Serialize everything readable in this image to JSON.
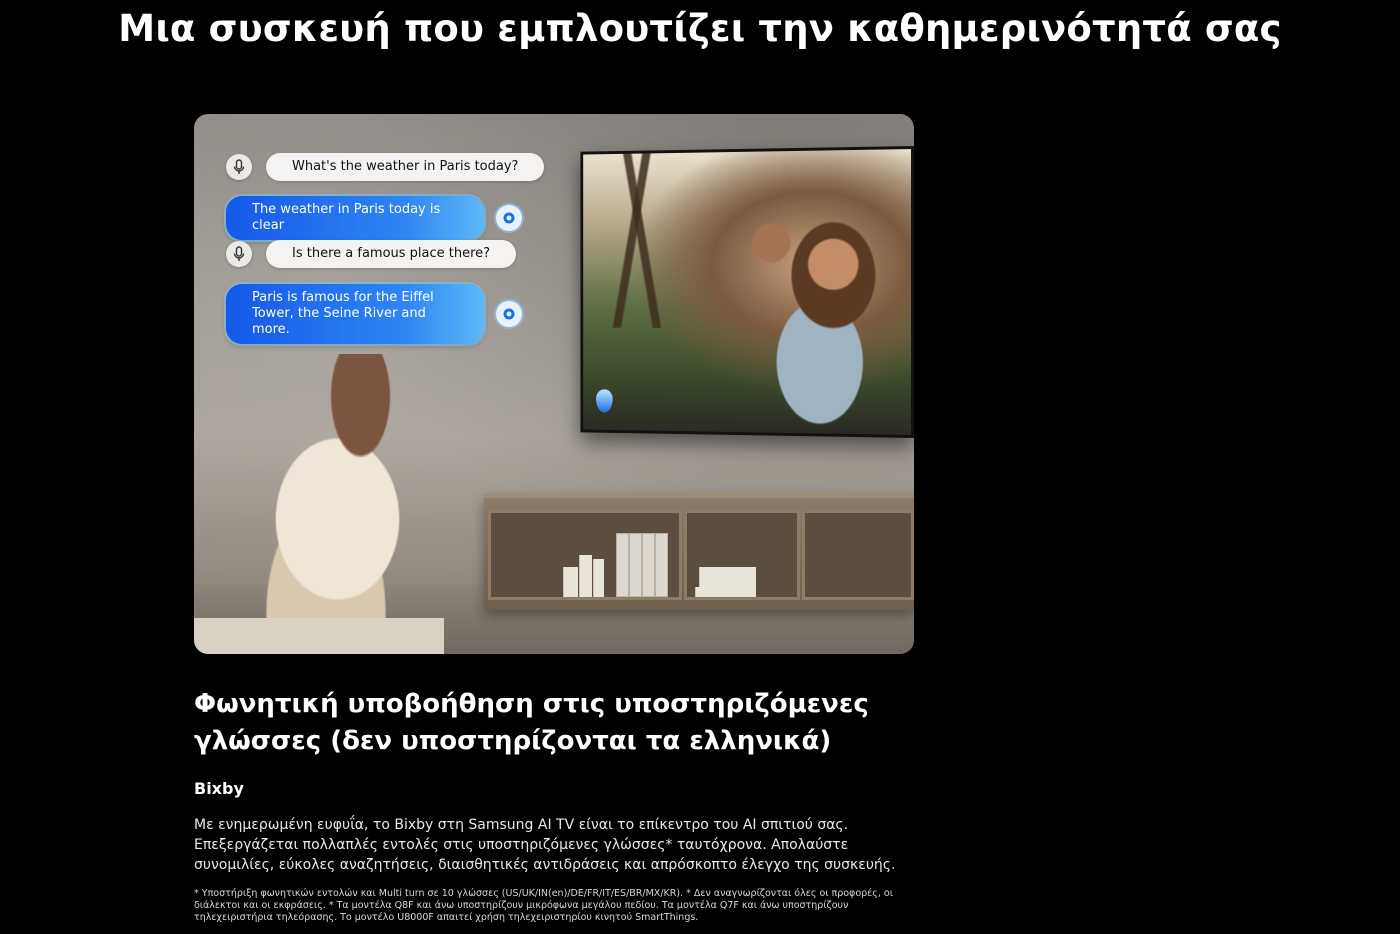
{
  "headline": "Μια συσκευή που εμπλουτίζει την καθημερινότητά σας",
  "hero": {
    "chat": [
      {
        "role": "user",
        "text": "What's the weather in Paris today?"
      },
      {
        "role": "assistant",
        "text": "The weather in Paris today is clear"
      },
      {
        "role": "user",
        "text": "Is there a famous place there?"
      },
      {
        "role": "assistant",
        "text": "Paris is famous for the Eiffel Tower, the Seine River and more."
      }
    ]
  },
  "feature": {
    "title": "Φωνητική υποβοήθηση στις υποστηριζόμενες γλώσσες (δεν υποστηρίζονται τα ελληνικά)",
    "subtitle": "Bixby",
    "description": "Με ενημερωμένη ευφυΐα, το Bixby στη Samsung AI TV είναι το επίκεντρο του AI σπιτιού σας. Επεξεργάζεται πολλαπλές εντολές στις υποστηριζόμενες γλώσσες* ταυτόχρονα. Απολαύστε συνομιλίες, εύκολες αναζητήσεις, διαισθητικές αντιδράσεις και απρόσκοπτο έλεγχο της συσκευής.",
    "footnote": "* Υποστήριξη φωνητικών εντολών και Multi turn σε 10 γλώσσες (US/UK/IN(en)/DE/FR/IT/ES/BR/MX/KR). * Δεν αναγνωρίζονται όλες οι προφορές, οι διάλεκτοι και οι εκφράσεις. * Τα μοντέλα Q8F και άνω υποστηρίζουν μικρόφωνα μεγάλου πεδίου. Τα μοντέλα Q7F και άνω υποστηρίζουν τηλεχειριστήρια τηλεόρασης. Το μοντέλο U8000F απαιτεί χρήση τηλεχειριστηρίου κινητού SmartThings."
  },
  "colors": {
    "background": "#000000",
    "assistant_bubble": "#1e6cf0",
    "user_bubble": "#f4f3f1"
  },
  "icons": [
    "mic-icon",
    "bixby-icon"
  ]
}
